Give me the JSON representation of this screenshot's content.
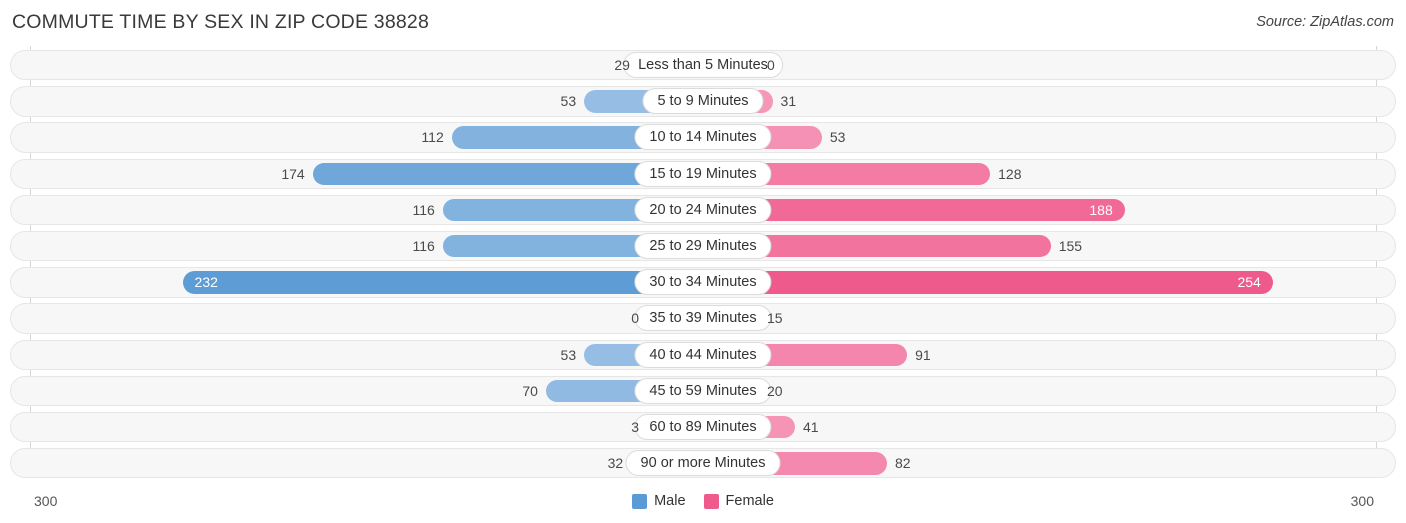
{
  "header": {
    "title": "COMMUTE TIME BY SEX IN ZIP CODE 38828",
    "source": "Source: ZipAtlas.com"
  },
  "legend": {
    "position": "bottom-center",
    "items": [
      {
        "label": "Male",
        "color": "#5b9bd5"
      },
      {
        "label": "Female",
        "color": "#ef5a8c"
      }
    ]
  },
  "axis": {
    "left_tick": "300",
    "right_tick": "300",
    "max": 300
  },
  "colors": {
    "male_strong": "#5b9bd5",
    "male_light": "#a7c7e7",
    "female_strong": "#ef5a8c",
    "female_light": "#f7a0bf",
    "track": "#f7f7f7",
    "track_border": "#e6e6e6",
    "text": "#4a4a4a"
  },
  "chart_data": {
    "type": "bar",
    "subtype": "diverging-horizontal",
    "title": "COMMUTE TIME BY SEX IN ZIP CODE 38828",
    "xlabel": "",
    "ylabel": "",
    "xlim": [
      0,
      300
    ],
    "grid": false,
    "legend_position": "bottom-center",
    "categories": [
      "Less than 5 Minutes",
      "5 to 9 Minutes",
      "10 to 14 Minutes",
      "15 to 19 Minutes",
      "20 to 24 Minutes",
      "25 to 29 Minutes",
      "30 to 34 Minutes",
      "35 to 39 Minutes",
      "40 to 44 Minutes",
      "45 to 59 Minutes",
      "60 to 89 Minutes",
      "90 or more Minutes"
    ],
    "series": [
      {
        "name": "Male",
        "values": [
          29,
          53,
          112,
          174,
          116,
          116,
          232,
          0,
          53,
          70,
          3,
          32
        ]
      },
      {
        "name": "Female",
        "values": [
          0,
          31,
          53,
          128,
          188,
          155,
          254,
          15,
          91,
          20,
          41,
          82
        ]
      }
    ]
  },
  "rows": [
    {
      "category": "Less than 5 Minutes",
      "male": "29",
      "female": "0",
      "male_value": 29,
      "female_value": 0
    },
    {
      "category": "5 to 9 Minutes",
      "male": "53",
      "female": "31",
      "male_value": 53,
      "female_value": 31
    },
    {
      "category": "10 to 14 Minutes",
      "male": "112",
      "female": "53",
      "male_value": 112,
      "female_value": 53
    },
    {
      "category": "15 to 19 Minutes",
      "male": "174",
      "female": "128",
      "male_value": 174,
      "female_value": 128
    },
    {
      "category": "20 to 24 Minutes",
      "male": "116",
      "female": "188",
      "male_value": 116,
      "female_value": 188
    },
    {
      "category": "25 to 29 Minutes",
      "male": "116",
      "female": "155",
      "male_value": 116,
      "female_value": 155
    },
    {
      "category": "30 to 34 Minutes",
      "male": "232",
      "female": "254",
      "male_value": 232,
      "female_value": 254
    },
    {
      "category": "35 to 39 Minutes",
      "male": "0",
      "female": "15",
      "male_value": 0,
      "female_value": 15
    },
    {
      "category": "40 to 44 Minutes",
      "male": "53",
      "female": "91",
      "male_value": 53,
      "female_value": 91
    },
    {
      "category": "45 to 59 Minutes",
      "male": "70",
      "female": "20",
      "male_value": 70,
      "female_value": 20
    },
    {
      "category": "60 to 89 Minutes",
      "male": "3",
      "female": "41",
      "male_value": 3,
      "female_value": 41
    },
    {
      "category": "90 or more Minutes",
      "male": "32",
      "female": "82",
      "male_value": 32,
      "female_value": 82
    }
  ]
}
